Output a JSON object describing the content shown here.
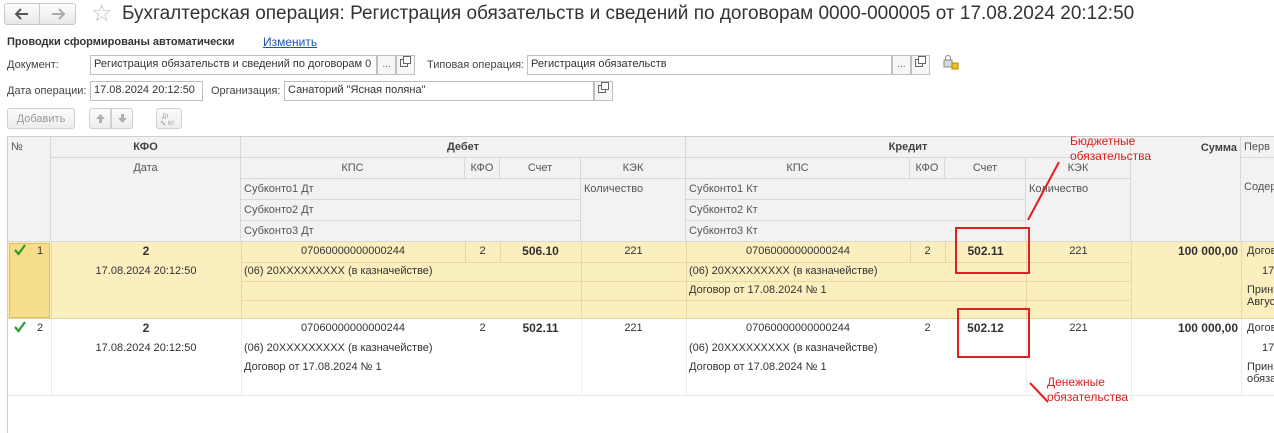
{
  "window": {
    "title": "Бухгалтерская операция: Регистрация обязательств и сведений по договорам 0000-000005 от 17.08.2024 20:12:50"
  },
  "header": {
    "auto_posting": "Проводки сформированы автоматически",
    "change_link": "Изменить",
    "document_label": "Документ:",
    "document_value": "Регистрация обязательств и сведений по договорам 0",
    "typical_op_label": "Типовая операция:",
    "typical_op_value": "Регистрация обязательств",
    "date_label": "Дата операции:",
    "date_value": "17.08.2024 20:12:50",
    "org_label": "Организация:",
    "org_value": "Санаторий \"Ясная поляна\"",
    "dots": "...",
    "add_button": "Добавить"
  },
  "columns": {
    "num": "№",
    "kfo": "КФО",
    "date": "Дата",
    "debit": "Дебет",
    "credit": "Кредит",
    "kps": "КПС",
    "kfo_small": "КФО",
    "account": "Счет",
    "kek": "КЭК",
    "quantity": "Количество",
    "subkonto1_dt": "Субконто1 Дт",
    "subkonto2_dt": "Субконто2 Дт",
    "subkonto3_dt": "Субконто3 Дт",
    "subkonto1_kt": "Субконто1 Кт",
    "subkonto2_kt": "Субконто2 Кт",
    "subkonto3_kt": "Субконто3 Кт",
    "sum": "Сумма",
    "primary": "Перв",
    "content": "Содер"
  },
  "rows": [
    {
      "num": "1",
      "kfo": "2",
      "date": "17.08.2024 20:12:50",
      "dt_kps": "07060000000000244",
      "dt_kfo": "2",
      "dt_account": "506.10",
      "dt_kek": "221",
      "dt_sub1": "(06) 20XXXXXXXXX (в казначействе)",
      "dt_sub2": "",
      "kt_kps": "07060000000000244",
      "kt_kfo": "2",
      "kt_account": "502.11",
      "kt_kek": "221",
      "kt_sub1": "(06) 20XXXXXXXXX (в казначействе)",
      "kt_sub2": "Договор от 17.08.2024 № 1",
      "sum": "100 000,00",
      "p1": "Догов",
      "p2": "17.",
      "p3": "Прин",
      "p4": "Авгус"
    },
    {
      "num": "2",
      "kfo": "2",
      "date": "17.08.2024 20:12:50",
      "dt_kps": "07060000000000244",
      "dt_kfo": "2",
      "dt_account": "502.11",
      "dt_kek": "221",
      "dt_sub1": "(06) 20XXXXXXXXX (в казначействе)",
      "dt_sub2": "Договор от 17.08.2024 № 1",
      "kt_kps": "07060000000000244",
      "kt_kfo": "2",
      "kt_account": "502.12",
      "kt_kek": "221",
      "kt_sub1": "(06) 20XXXXXXXXX (в казначействе)",
      "kt_sub2": "Договор от 17.08.2024 № 1",
      "sum": "100 000,00",
      "p1": "Догов",
      "p2": "17.",
      "p3": "Прин",
      "p4": "обяза"
    }
  ],
  "annotations": {
    "budget_line1": "Бюджетные",
    "budget_line2": "обязательства",
    "money_line1": "Денежные",
    "money_line2": "обязательства"
  },
  "colors": {
    "selected_row": "#fbefbf",
    "annotation": "#e02020",
    "link": "#1a55b0",
    "check": "#2e9a2e"
  }
}
